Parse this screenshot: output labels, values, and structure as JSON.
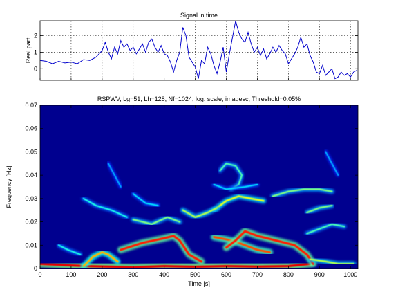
{
  "chart_data": [
    {
      "type": "line",
      "title": "Signal in time",
      "xlabel": "",
      "ylabel": "Real part",
      "xlim": [
        0,
        1024
      ],
      "ylim": [
        -0.7,
        2.9
      ],
      "yticks": [
        0,
        1,
        2
      ],
      "grid": true,
      "color": "#0000cc",
      "series": [
        {
          "x": [
            0,
            20,
            40,
            60,
            80,
            100,
            120,
            140,
            160,
            180,
            200,
            210,
            220,
            230,
            240,
            250,
            260,
            270,
            280,
            290,
            300,
            310,
            320,
            330,
            340,
            350,
            360,
            370,
            380,
            390,
            400,
            410,
            420,
            430,
            440,
            450,
            460,
            470,
            480,
            490,
            500,
            510,
            520,
            530,
            540,
            550,
            560,
            570,
            580,
            590,
            600,
            610,
            620,
            630,
            640,
            650,
            660,
            670,
            680,
            690,
            700,
            710,
            720,
            730,
            740,
            750,
            760,
            770,
            780,
            790,
            800,
            810,
            820,
            830,
            840,
            850,
            860,
            870,
            880,
            890,
            900,
            910,
            920,
            930,
            940,
            950,
            960,
            970,
            980,
            990,
            1000,
            1010,
            1020
          ],
          "y": [
            0.5,
            0.45,
            0.3,
            0.45,
            0.35,
            0.4,
            0.3,
            0.55,
            0.5,
            0.7,
            1.1,
            1.6,
            1.0,
            0.6,
            1.3,
            0.9,
            1.7,
            1.3,
            1.5,
            1.1,
            1.3,
            0.9,
            1.2,
            1.5,
            1.0,
            1.6,
            1.8,
            1.3,
            1.0,
            1.4,
            0.9,
            0.8,
            0.4,
            -0.2,
            0.5,
            1.0,
            2.5,
            2.0,
            0.7,
            0.4,
            0.1,
            -0.6,
            0.5,
            0.3,
            1.3,
            0.9,
            0.2,
            -0.3,
            0.4,
            1.3,
            -0.2,
            0.9,
            1.9,
            2.9,
            2.2,
            1.8,
            1.6,
            2.2,
            1.5,
            1.0,
            1.3,
            0.8,
            1.2,
            0.6,
            0.9,
            1.3,
            1.0,
            1.4,
            1.1,
            0.9,
            0.3,
            0.6,
            0.9,
            1.3,
            1.9,
            1.3,
            1.5,
            0.8,
            0.4,
            -0.2,
            -0.3,
            0.2,
            -0.4,
            -0.2,
            0.0,
            -0.6,
            -0.5,
            -0.2,
            -0.4,
            -0.3,
            -0.5,
            -0.2,
            -0.1
          ]
        }
      ]
    },
    {
      "type": "heatmap",
      "title": "RSPWV, Lg=51, Lh=128, Nf=1024, log. scale, imagesc, Threshold=0.05%",
      "xlabel": "Time [s]",
      "ylabel": "Frequency [Hz]",
      "xlim": [
        0,
        1024
      ],
      "ylim": [
        0,
        0.07
      ],
      "xticks": [
        0,
        100,
        200,
        300,
        400,
        500,
        600,
        700,
        800,
        900,
        1000
      ],
      "yticks": [
        "0",
        "0.01",
        "0.02",
        "0.03",
        "0.04",
        "0.05",
        "0.06",
        "0.07"
      ],
      "colormap": "jet",
      "background_color": "#00008f",
      "ridges": [
        {
          "level": 0.9,
          "points": [
            [
              0,
              0.002
            ],
            [
              150,
              0.001
            ],
            [
              300,
              0.0005
            ],
            [
              400,
              0.001
            ],
            [
              500,
              0.0007
            ],
            [
              600,
              0.001
            ],
            [
              700,
              0.0008
            ],
            [
              800,
              0.001
            ],
            [
              870,
              0.002
            ]
          ]
        },
        {
          "level": 0.85,
          "points": [
            [
              260,
              0.008
            ],
            [
              330,
              0.011
            ],
            [
              400,
              0.013
            ],
            [
              430,
              0.014
            ],
            [
              450,
              0.012
            ],
            [
              480,
              0.006
            ],
            [
              520,
              0.003
            ]
          ]
        },
        {
          "level": 0.8,
          "points": [
            [
              560,
              0.0135
            ],
            [
              600,
              0.0125
            ],
            [
              630,
              0.0115
            ],
            [
              660,
              0.01
            ],
            [
              700,
              0.008
            ],
            [
              740,
              0.007
            ]
          ]
        },
        {
          "level": 0.85,
          "points": [
            [
              600,
              0.009
            ],
            [
              630,
              0.012
            ],
            [
              660,
              0.016
            ],
            [
              700,
              0.014
            ],
            [
              760,
              0.012
            ],
            [
              820,
              0.01
            ],
            [
              860,
              0.006
            ],
            [
              880,
              0.002
            ]
          ]
        },
        {
          "level": 0.7,
          "points": [
            [
              140,
              0.001
            ],
            [
              170,
              0.005
            ],
            [
              200,
              0.007
            ],
            [
              220,
              0.006
            ],
            [
              250,
              0.003
            ]
          ]
        },
        {
          "level": 0.6,
          "points": [
            [
              560,
              0.025
            ],
            [
              600,
              0.029
            ],
            [
              640,
              0.031
            ],
            [
              680,
              0.03
            ],
            [
              720,
              0.029
            ]
          ]
        },
        {
          "level": 0.55,
          "points": [
            [
              460,
              0.025
            ],
            [
              500,
              0.022
            ],
            [
              540,
              0.024
            ],
            [
              570,
              0.026
            ]
          ]
        },
        {
          "level": 0.5,
          "points": [
            [
              300,
              0.021
            ],
            [
              360,
              0.019
            ],
            [
              410,
              0.022
            ],
            [
              450,
              0.02
            ]
          ]
        },
        {
          "level": 0.5,
          "points": [
            [
              750,
              0.031
            ],
            [
              800,
              0.033
            ],
            [
              850,
              0.034
            ],
            [
              900,
              0.034
            ],
            [
              940,
              0.033
            ]
          ]
        },
        {
          "level": 0.5,
          "points": [
            [
              860,
              0.024
            ],
            [
              900,
              0.026
            ],
            [
              940,
              0.027
            ]
          ]
        },
        {
          "level": 0.45,
          "points": [
            [
              580,
              0.042
            ],
            [
              600,
              0.045
            ],
            [
              630,
              0.044
            ],
            [
              650,
              0.04
            ],
            [
              640,
              0.036
            ],
            [
              615,
              0.034
            ]
          ]
        },
        {
          "level": 0.45,
          "points": [
            [
              860,
              0.015
            ],
            [
              900,
              0.017
            ],
            [
              940,
              0.019
            ],
            [
              980,
              0.018
            ]
          ]
        },
        {
          "level": 0.4,
          "points": [
            [
              140,
              0.03
            ],
            [
              180,
              0.027
            ],
            [
              230,
              0.025
            ],
            [
              280,
              0.022
            ]
          ]
        },
        {
          "level": 0.55,
          "points": [
            [
              870,
              0.004
            ],
            [
              920,
              0.003
            ],
            [
              960,
              0.002
            ],
            [
              1010,
              0.002
            ]
          ]
        },
        {
          "level": 0.4,
          "points": [
            [
              60,
              0.01
            ],
            [
              90,
              0.008
            ],
            [
              130,
              0.006
            ]
          ]
        },
        {
          "level": 0.35,
          "points": [
            [
              300,
              0.032
            ],
            [
              340,
              0.028
            ],
            [
              380,
              0.027
            ]
          ]
        },
        {
          "level": 0.35,
          "points": [
            [
              560,
              0.036
            ],
            [
              600,
              0.034
            ],
            [
              660,
              0.035
            ],
            [
              700,
              0.036
            ]
          ]
        },
        {
          "level": 0.3,
          "points": [
            [
              220,
              0.045
            ],
            [
              240,
              0.04
            ],
            [
              260,
              0.035
            ]
          ]
        },
        {
          "level": 0.3,
          "points": [
            [
              920,
              0.05
            ],
            [
              940,
              0.045
            ],
            [
              960,
              0.04
            ]
          ]
        }
      ]
    }
  ]
}
